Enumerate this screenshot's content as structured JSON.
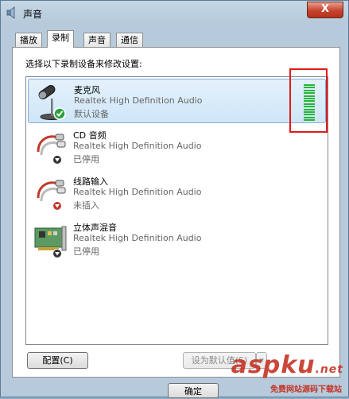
{
  "window": {
    "title": "声音",
    "close_label": "X"
  },
  "tabs": [
    {
      "label": "播放"
    },
    {
      "label": "录制"
    },
    {
      "label": "声音"
    },
    {
      "label": "通信"
    }
  ],
  "panel": {
    "instruction": "选择以下录制设备来修改设置:"
  },
  "devices": [
    {
      "name": "麦克风",
      "description": "Realtek High Definition Audio",
      "status": "默认设备",
      "icon": "microphone-icon",
      "badge": "default-check-icon",
      "selected": true,
      "level_bars": 14
    },
    {
      "name": "CD 音频",
      "description": "Realtek High Definition Audio",
      "status": "已停用",
      "icon": "rca-cable-icon",
      "badge": "disabled-arrow-icon"
    },
    {
      "name": "线路输入",
      "description": "Realtek High Definition Audio",
      "status": "未插入",
      "icon": "rca-cable-icon",
      "badge": "unplugged-arrow-icon"
    },
    {
      "name": "立体声混音",
      "description": "Realtek High Definition Audio",
      "status": "已停用",
      "icon": "sound-card-icon",
      "badge": "disabled-arrow-icon"
    }
  ],
  "buttons": {
    "configure": "配置(C)",
    "set_default": "设为默认值(S)",
    "ok": "确定"
  },
  "watermark": {
    "text": "aspku",
    "suffix": ".net",
    "sub": "免费网站源码下载站"
  },
  "colors": {
    "meter": "#27b53a",
    "highlight": "#e01b1b",
    "selection": "#cfe6f8"
  }
}
